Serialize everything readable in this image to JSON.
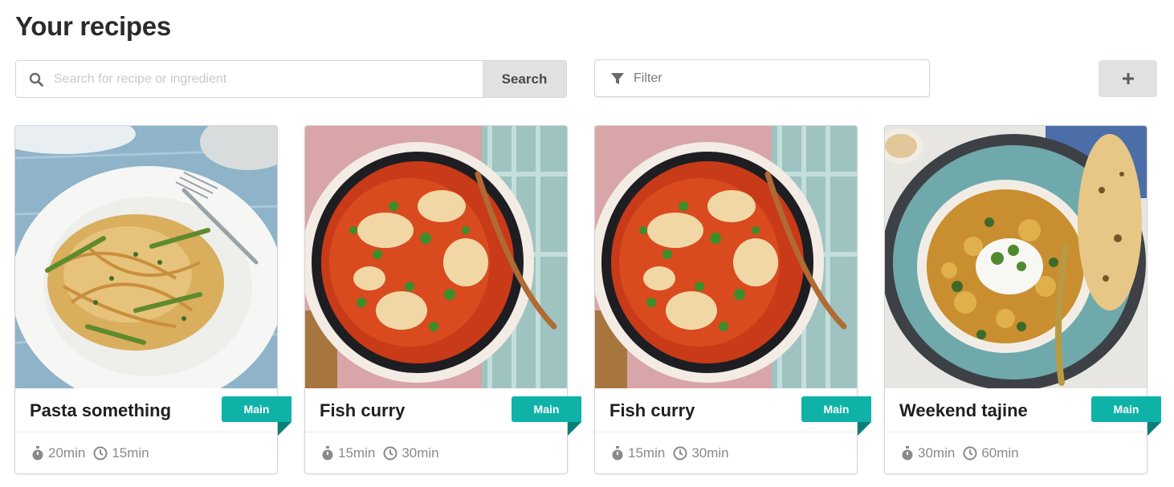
{
  "page": {
    "title": "Your recipes"
  },
  "search": {
    "placeholder": "Search for recipe or ingredient",
    "button_label": "Search",
    "icon": "search-icon"
  },
  "filter": {
    "placeholder": "Filter",
    "icon": "filter-icon"
  },
  "add_button": {
    "icon": "plus-icon"
  },
  "colors": {
    "ribbon": "#0fb2a7",
    "button_bg": "#e0e1e2"
  },
  "recipes": [
    {
      "title": "Pasta something",
      "category": "Main",
      "prep_time": "20min",
      "cook_time": "15min",
      "image": "pasta-photo"
    },
    {
      "title": "Fish curry",
      "category": "Main",
      "prep_time": "15min",
      "cook_time": "30min",
      "image": "fish-curry-photo"
    },
    {
      "title": "Fish curry",
      "category": "Main",
      "prep_time": "15min",
      "cook_time": "30min",
      "image": "fish-curry-photo"
    },
    {
      "title": "Weekend tajine",
      "category": "Main",
      "prep_time": "30min",
      "cook_time": "60min",
      "image": "tajine-photo"
    }
  ]
}
